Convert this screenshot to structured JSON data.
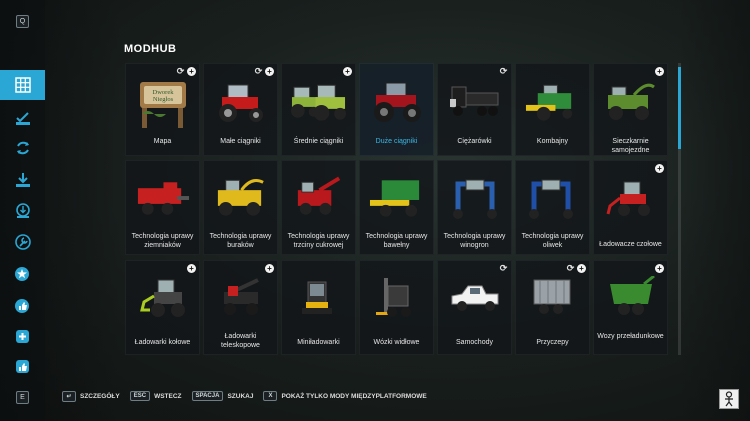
{
  "sidebar": {
    "top_key": "Q",
    "bottom_key": "E",
    "items": [
      {
        "icon": "grid-icon"
      },
      {
        "icon": "checklist-icon"
      },
      {
        "icon": "sync-icon"
      },
      {
        "icon": "download-icon"
      },
      {
        "icon": "install-icon"
      },
      {
        "icon": "wrench-icon"
      },
      {
        "icon": "star-icon"
      },
      {
        "icon": "thumb-icon"
      },
      {
        "icon": "plus-icon"
      },
      {
        "icon": "like-icon"
      }
    ]
  },
  "header": {
    "title": "MODHUB"
  },
  "categories": [
    {
      "label": "Mapa",
      "plus": true,
      "sync": true,
      "sign_text": [
        "Dworek",
        "Niegłos"
      ]
    },
    {
      "label": "Małe ciągniki",
      "plus": true,
      "sync": true
    },
    {
      "label": "Średnie ciągniki",
      "plus": true,
      "sync": false
    },
    {
      "label": "Duże ciągniki",
      "plus": false,
      "sync": false,
      "selected": true
    },
    {
      "label": "Ciężarówki",
      "plus": false,
      "sync": true
    },
    {
      "label": "Kombajny",
      "plus": false,
      "sync": false
    },
    {
      "label": "Sieczkarnie samojezdne",
      "plus": true,
      "sync": false
    },
    {
      "label": "Technologia uprawy ziemniaków",
      "plus": false,
      "sync": false
    },
    {
      "label": "Technologia uprawy buraków",
      "plus": false,
      "sync": false
    },
    {
      "label": "Technologia uprawy trzciny cukrowej",
      "plus": false,
      "sync": false
    },
    {
      "label": "Technologia uprawy bawełny",
      "plus": false,
      "sync": false
    },
    {
      "label": "Technologia uprawy winogron",
      "plus": false,
      "sync": false
    },
    {
      "label": "Technologia uprawy oliwek",
      "plus": false,
      "sync": false
    },
    {
      "label": "Ładowacze czołowe",
      "plus": true,
      "sync": false
    },
    {
      "label": "Ładowarki kołowe",
      "plus": true,
      "sync": false
    },
    {
      "label": "Ładowarki teleskopowe",
      "plus": true,
      "sync": false
    },
    {
      "label": "Miniładowarki",
      "plus": false,
      "sync": false
    },
    {
      "label": "Wózki widłowe",
      "plus": false,
      "sync": false
    },
    {
      "label": "Samochody",
      "plus": false,
      "sync": true
    },
    {
      "label": "Przyczepy",
      "plus": true,
      "sync": true
    },
    {
      "label": "Wozy przeładunkowe",
      "plus": true,
      "sync": false
    }
  ],
  "footer": {
    "hints": [
      {
        "key": "↵",
        "label": "SZCZEGÓŁY"
      },
      {
        "key": "ESC",
        "label": "WSTECZ"
      },
      {
        "key": "SPACJA",
        "label": "SZUKAJ"
      },
      {
        "key": "X",
        "label": "POKAŻ TYLKO MODY MIĘDZYPLATFORMOWE"
      }
    ]
  },
  "colors": {
    "accent": "#2aa7d4",
    "tile_bg": "#12161a"
  }
}
